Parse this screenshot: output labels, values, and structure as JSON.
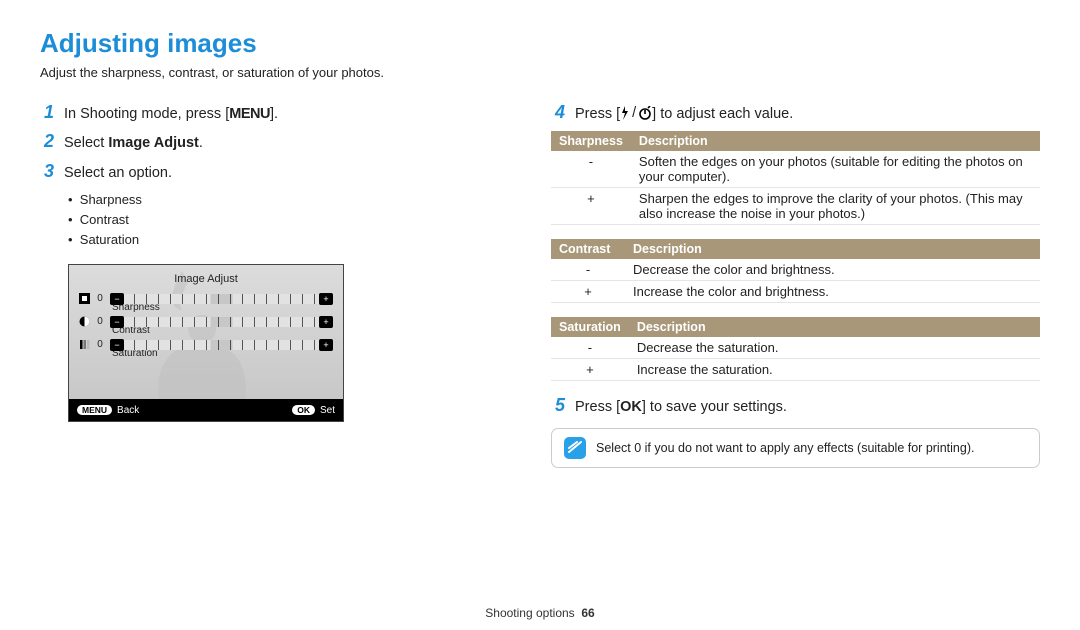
{
  "title": "Adjusting images",
  "subtitle": "Adjust the sharpness, contrast, or saturation of your photos.",
  "steps": {
    "s1": {
      "n": "1",
      "pre": "In Shooting mode, press [",
      "btn": "MENU",
      "post": "]."
    },
    "s2": {
      "n": "2",
      "pre": "Select ",
      "bold": "Image Adjust",
      "post": "."
    },
    "s3": {
      "n": "3",
      "text": "Select an option."
    },
    "s4": {
      "n": "4",
      "pre": "Press [",
      "post": "] to adjust each value."
    },
    "s5": {
      "n": "5",
      "pre": "Press [",
      "btn": "OK",
      "post": "] to save your settings."
    }
  },
  "options": [
    "Sharpness",
    "Contrast",
    "Saturation"
  ],
  "shooting_preview": {
    "title": "Image Adjust",
    "rows": {
      "sharpness": {
        "value": "0",
        "label": "Sharpness"
      },
      "contrast": {
        "value": "0",
        "label": "Contrast"
      },
      "saturation": {
        "value": "0",
        "label": "Saturation"
      }
    },
    "back_btn": "MENU",
    "back_label": "Back",
    "ok_btn": "OK",
    "set_label": "Set"
  },
  "tables": {
    "sharpness": {
      "h1": "Sharpness",
      "h2": "Description",
      "r1s": "-",
      "r1d": "Soften the edges on your photos (suitable for editing the photos on your computer).",
      "r2s": "+",
      "r2d": "Sharpen the edges to improve the clarity of your photos. (This may also increase the noise in your photos.)"
    },
    "contrast": {
      "h1": "Contrast",
      "h2": "Description",
      "r1s": "-",
      "r1d": "Decrease the color and brightness.",
      "r2s": "+",
      "r2d": "Increase the color and brightness."
    },
    "saturation": {
      "h1": "Saturation",
      "h2": "Description",
      "r1s": "-",
      "r1d": "Decrease the saturation.",
      "r2s": "+",
      "r2d": "Increase the saturation."
    }
  },
  "note": "Select 0 if you do not want to apply any effects (suitable for printing).",
  "footer": {
    "section": "Shooting options",
    "page": "66"
  }
}
